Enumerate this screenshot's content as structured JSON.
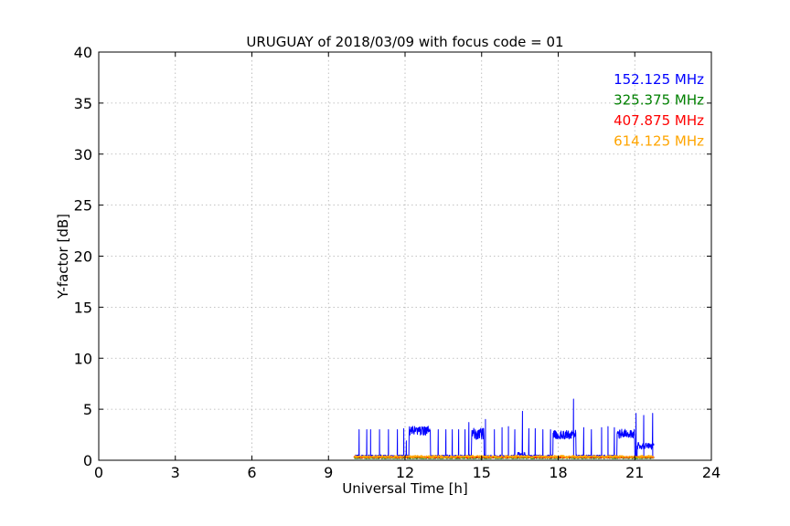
{
  "chart_data": {
    "type": "line",
    "title": "URUGUAY of 2018/03/09 with focus code = 01",
    "xlabel": "Universal Time [h]",
    "ylabel": "Y-factor [dB]",
    "xlim": [
      0,
      24
    ],
    "ylim": [
      0,
      40
    ],
    "xticks": [
      0,
      3,
      6,
      9,
      12,
      15,
      18,
      21,
      24
    ],
    "yticks": [
      0,
      5,
      10,
      15,
      20,
      25,
      30,
      35,
      40
    ],
    "grid": true,
    "legend_position": "top-right",
    "series": [
      {
        "name": "152.125 MHz",
        "color": "#0000ff",
        "x_range": [
          10.0,
          21.75
        ],
        "baseline": 0.4,
        "bursts": [
          [
            12.15,
            13.0,
            2.9,
            0.45
          ],
          [
            14.6,
            15.1,
            2.6,
            0.55
          ],
          [
            17.8,
            18.7,
            2.5,
            0.45
          ],
          [
            20.3,
            21.0,
            2.6,
            0.45
          ],
          [
            21.1,
            21.75,
            1.4,
            0.35
          ],
          [
            16.4,
            16.7,
            0.6,
            0.2
          ],
          [
            19.0,
            19.6,
            0.3,
            0.15
          ]
        ],
        "spikes": [
          [
            10.2,
            3.0
          ],
          [
            10.5,
            3.0
          ],
          [
            10.65,
            3.0
          ],
          [
            11.0,
            3.0
          ],
          [
            11.35,
            3.0
          ],
          [
            11.7,
            3.0
          ],
          [
            11.95,
            3.1
          ],
          [
            12.05,
            1.9
          ],
          [
            13.3,
            3.0
          ],
          [
            13.6,
            3.0
          ],
          [
            13.85,
            3.0
          ],
          [
            14.1,
            3.0
          ],
          [
            14.35,
            3.0
          ],
          [
            14.5,
            3.7
          ],
          [
            15.15,
            4.0
          ],
          [
            15.5,
            3.0
          ],
          [
            15.8,
            3.2
          ],
          [
            16.05,
            3.3
          ],
          [
            16.3,
            3.0
          ],
          [
            16.6,
            4.8
          ],
          [
            16.85,
            3.1
          ],
          [
            17.1,
            3.1
          ],
          [
            17.4,
            3.0
          ],
          [
            17.7,
            3.0
          ],
          [
            18.6,
            6.0
          ],
          [
            19.0,
            3.2
          ],
          [
            19.3,
            3.0
          ],
          [
            19.7,
            3.2
          ],
          [
            19.95,
            3.3
          ],
          [
            20.2,
            3.2
          ],
          [
            21.05,
            4.6
          ],
          [
            21.35,
            4.4
          ],
          [
            21.7,
            4.6
          ]
        ]
      },
      {
        "name": "325.375 MHz",
        "color": "#008000",
        "x_range": [
          10.0,
          21.75
        ],
        "level": 0.22,
        "noise": 0.06
      },
      {
        "name": "407.875 MHz",
        "color": "#ff0000",
        "x_range": [
          10.0,
          21.75
        ],
        "level": 0.3,
        "noise": 0.08
      },
      {
        "name": "614.125 MHz",
        "color": "#ffa500",
        "x_range": [
          10.0,
          21.75
        ],
        "level": 0.35,
        "noise": 0.12
      }
    ]
  }
}
